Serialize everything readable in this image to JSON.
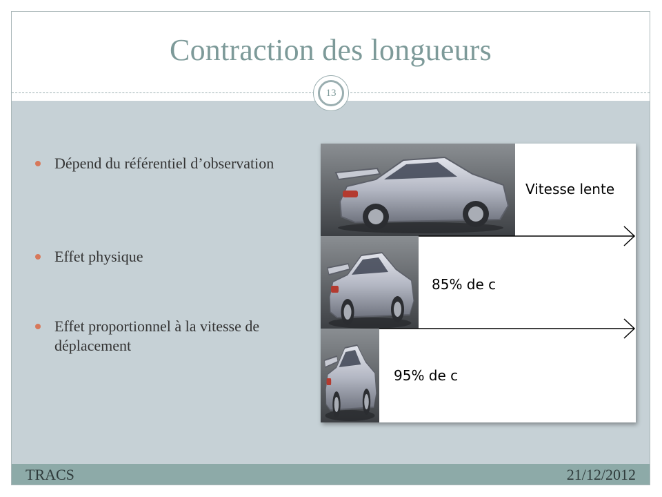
{
  "slide": {
    "title": "Contraction des longueurs",
    "number": "13",
    "bullets": [
      "Dépend du référentiel d’observation",
      "Effet physique",
      "Effet proportionnel à la vitesse de déplacement"
    ],
    "figure": {
      "rows": [
        {
          "label": "Vitesse lente"
        },
        {
          "label": "85% de c"
        },
        {
          "label": "95% de c"
        }
      ]
    },
    "footer": {
      "left": "TRACS",
      "right": "21/12/2012"
    }
  },
  "colors": {
    "title": "#7d9a99",
    "content_bg": "#c6d1d6",
    "footer_bg": "#8daaa8",
    "bullet_dot": "#d7785a",
    "car_silver": "#b9bcc6"
  }
}
